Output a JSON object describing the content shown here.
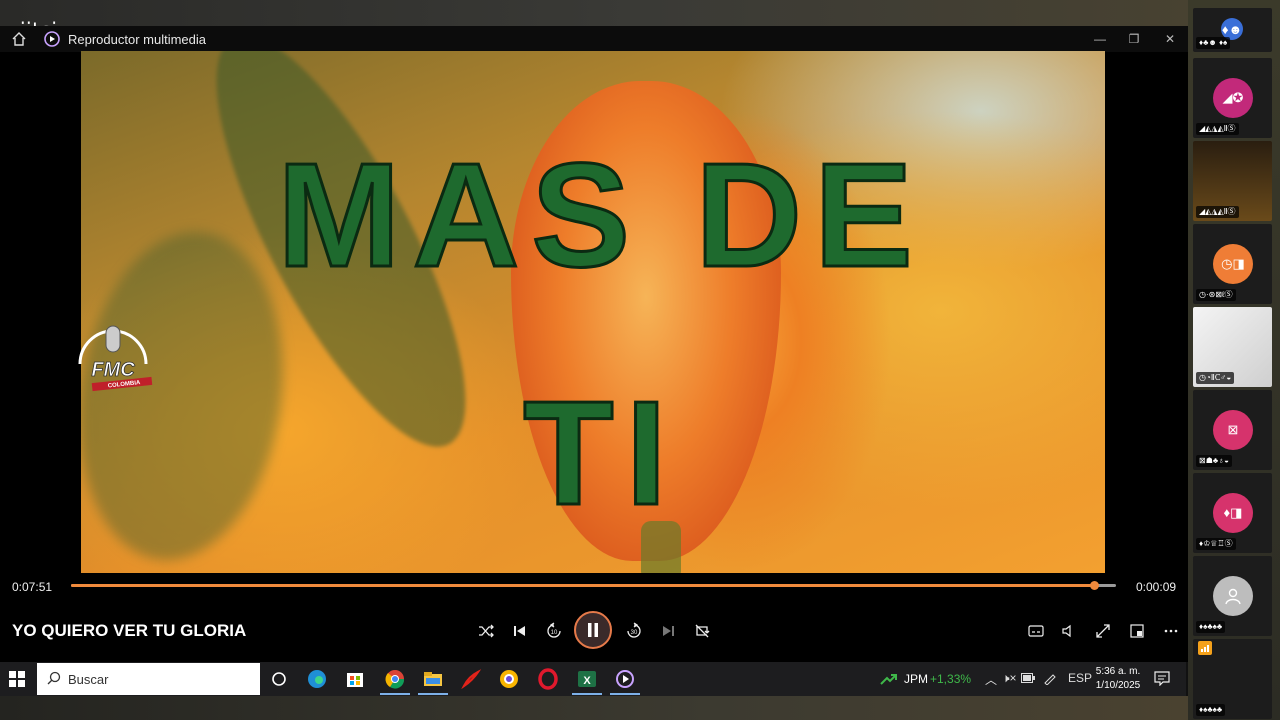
{
  "jitsi": {
    "logo": "jitsi",
    "participants": [
      {
        "label": "♦♣☻ ♦♠",
        "avatar_text": "♦☻",
        "color": "#3a6fd8"
      },
      {
        "label": "◢◭◮◭ⅡⓈ",
        "avatar_text": "◢✪",
        "color": "#c2297a"
      },
      {
        "label": "◢◭◮◭ⅡⓈ",
        "avatar_text": "",
        "color": ""
      },
      {
        "label": "◷·⊛⊠ℓⓈ",
        "avatar_text": "◷◨",
        "color": "#ef7d36"
      },
      {
        "label": "◷◔ⅡⅭ♂◒",
        "avatar_text": "",
        "color": ""
      },
      {
        "label": "⊠☗♣♁◒",
        "avatar_text": "⊠",
        "color": "#d6336c"
      },
      {
        "label": "♦♔♕♖Ⓢ",
        "avatar_text": "♦◨",
        "color": "#d6336c"
      },
      {
        "label": "♦♠♣♠♣",
        "avatar_text": "",
        "color": "#bdbdbd"
      },
      {
        "label": "♦♠♣♠♣",
        "avatar_text": "",
        "color": ""
      }
    ]
  },
  "player": {
    "window_title": "Reproductor multimedia",
    "lyrics": {
      "line1": "MAS DE",
      "line2": "TI"
    },
    "elapsed": "0:07:51",
    "remaining": "0:00:09",
    "progress_fraction": 0.979,
    "song_title": "YO QUIERO VER TU GLORIA",
    "skip_back_seconds": "10",
    "skip_forward_seconds": "30",
    "accent_color": "#f08a3c"
  },
  "watermark": {
    "text": "FMC",
    "subtext": "COLOMBIA"
  },
  "taskbar": {
    "search_placeholder": "Buscar",
    "stock_symbol": "JPM",
    "stock_change": "+1,33%",
    "language": "ESP",
    "time": "5:36 a. m.",
    "date": "1/10/2025"
  }
}
